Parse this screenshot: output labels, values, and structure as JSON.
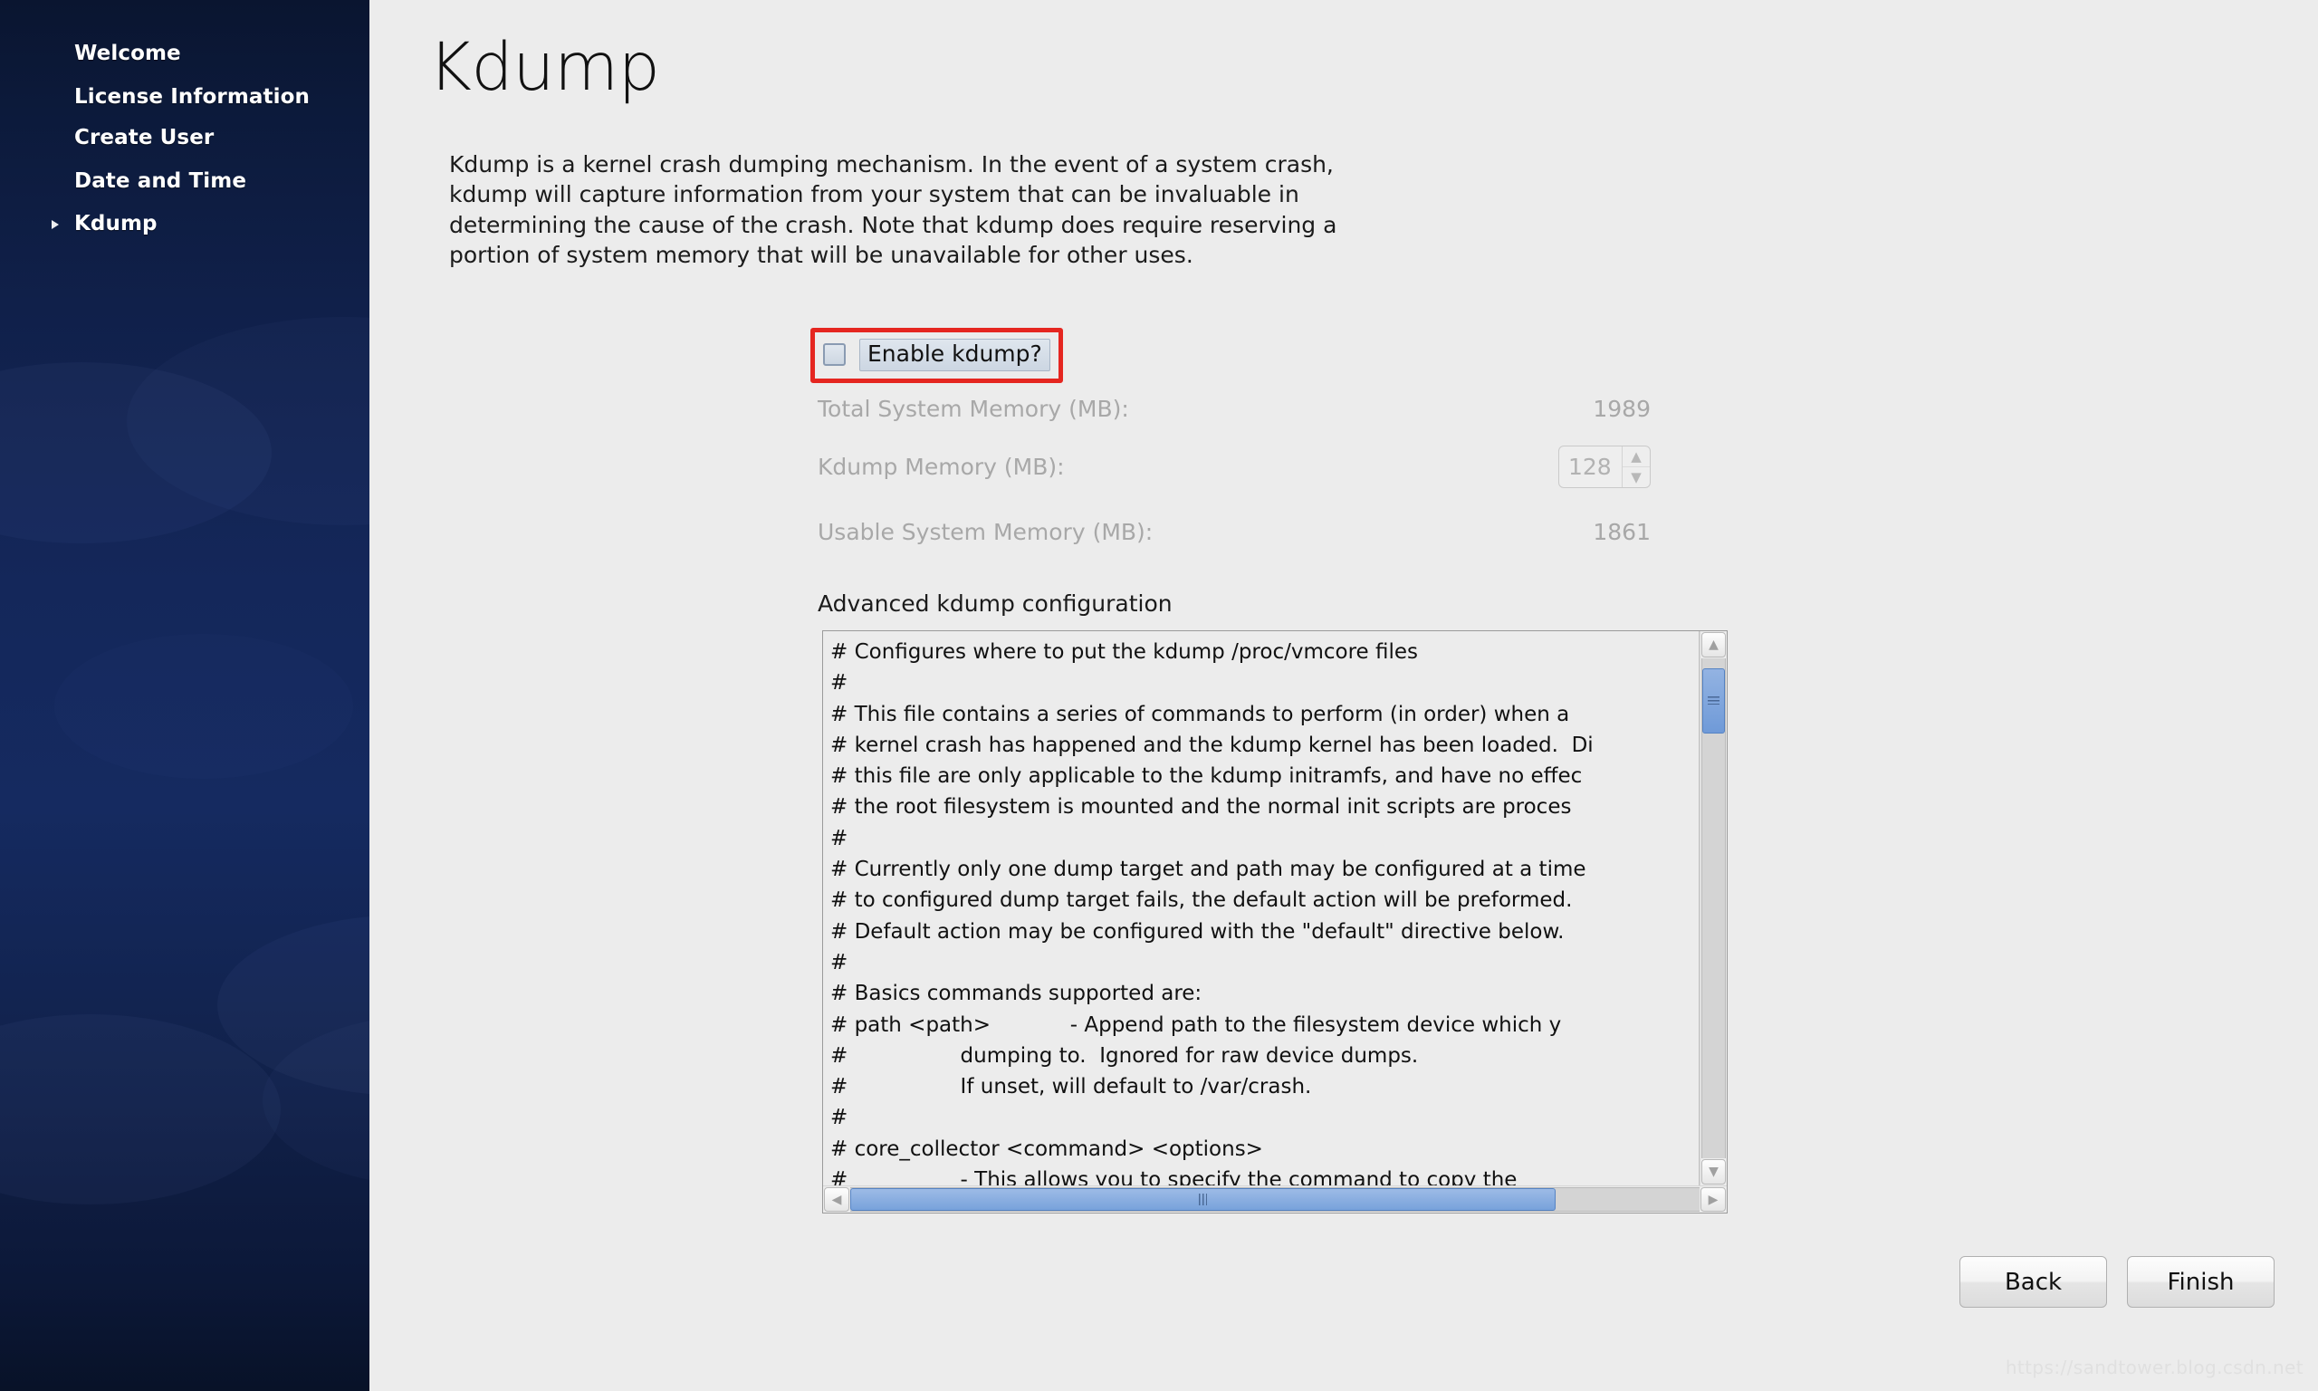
{
  "sidebar": {
    "items": [
      {
        "label": "Welcome",
        "active": false
      },
      {
        "label": "License Information",
        "active": false
      },
      {
        "label": "Create User",
        "active": false
      },
      {
        "label": "Date and Time",
        "active": false
      },
      {
        "label": "Kdump",
        "active": true
      }
    ]
  },
  "main": {
    "title": "Kdump",
    "intro": "Kdump is a kernel crash dumping mechanism. In the event of a system crash, kdump will capture information from your system that can be invaluable in determining the cause of the crash. Note that kdump does require reserving a portion of system memory that will be unavailable for other uses.",
    "enable": {
      "label": "Enable kdump?",
      "checked": false,
      "highlight_color": "#e52620"
    },
    "memory": {
      "total_label": "Total System Memory (MB):",
      "total_value": "1989",
      "kdump_label": "Kdump Memory (MB):",
      "kdump_value": "128",
      "usable_label": "Usable System Memory (MB):",
      "usable_value": "1861",
      "disabled": true
    },
    "advanced": {
      "label": "Advanced kdump configuration",
      "content": "# Configures where to put the kdump /proc/vmcore files\n#\n# This file contains a series of commands to perform (in order) when a\n# kernel crash has happened and the kdump kernel has been loaded.  Di\n# this file are only applicable to the kdump initramfs, and have no effec\n# the root filesystem is mounted and the normal init scripts are proces\n#\n# Currently only one dump target and path may be configured at a time\n# to configured dump target fails, the default action will be preformed.\n# Default action may be configured with the \"default\" directive below.\n#\n# Basics commands supported are:\n# path <path>            - Append path to the filesystem device which y\n#                 dumping to.  Ignored for raw device dumps.\n#                 If unset, will default to /var/crash.\n#\n# core_collector <command> <options>\n#                 - This allows you to specify the command to copy the"
    },
    "scrollbars": {
      "vertical_up_icon": "chevron-up-icon",
      "vertical_down_icon": "chevron-down-icon",
      "horizontal_left_icon": "chevron-left-icon",
      "horizontal_right_icon": "chevron-right-icon",
      "vertical_thumb_position_pct": 2,
      "vertical_thumb_size_pct": 13,
      "horizontal_thumb_size_pct": 83,
      "thumb_color": "#78a2db"
    },
    "footer": {
      "back_label": "Back",
      "finish_label": "Finish"
    },
    "watermark": "https://sandtower.blog.csdn.net"
  }
}
